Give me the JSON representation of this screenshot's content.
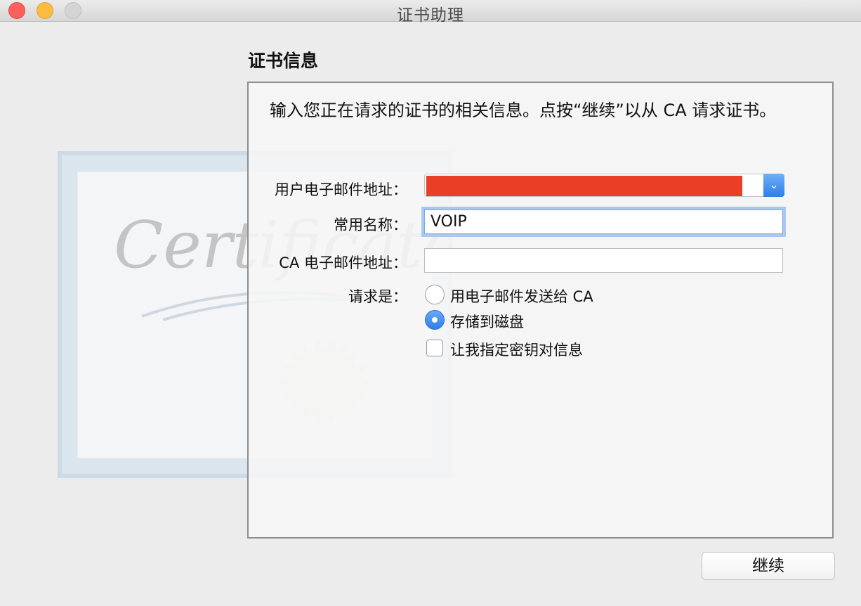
{
  "window": {
    "title": "证书助理",
    "controls": [
      "close",
      "minimize",
      "zoom"
    ]
  },
  "section_title": "证书信息",
  "description": "输入您正在请求的证书的相关信息。点按“继续”以从 CA 请求证书。",
  "background_art": {
    "script_text": "Certificate",
    "icon": "certificate-art-icon"
  },
  "form": {
    "email_label": "用户电子邮件地址：",
    "email_value_redacted": true,
    "email_redaction_color": "#ea3e26",
    "common_name_label": "常用名称：",
    "common_name_value": "VOIP",
    "ca_email_label": "CA 电子邮件地址：",
    "ca_email_value": "",
    "request_label": "请求是：",
    "options": [
      {
        "label": "用电子邮件发送给 CA",
        "selected": false
      },
      {
        "label": "存储到磁盘",
        "selected": true
      }
    ],
    "key_pair_checkbox_label": "让我指定密钥对信息",
    "key_pair_checked": false
  },
  "buttons": {
    "continue_label": "继续"
  },
  "colors": {
    "accent": "#2f7fe6",
    "focus_ring": "#a8c8f2"
  }
}
